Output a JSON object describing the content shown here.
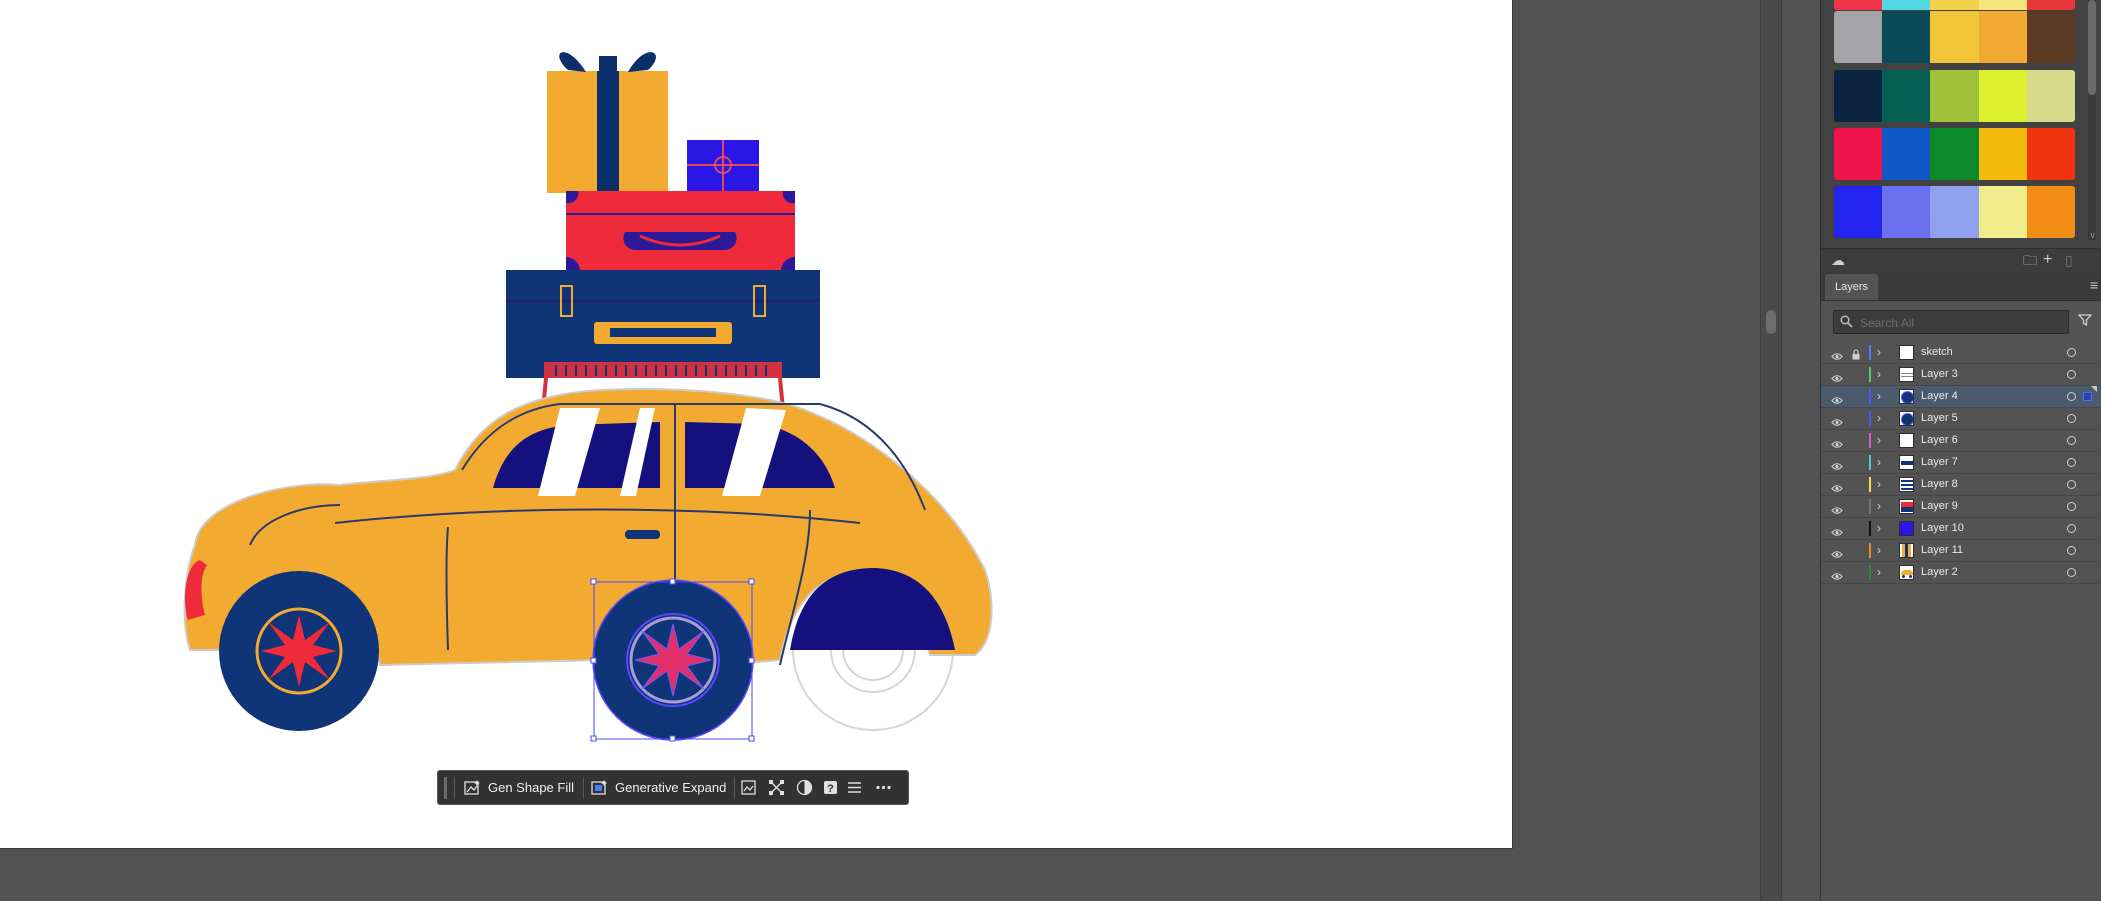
{
  "task_bar": {
    "gen_shape_fill": "Gen Shape Fill",
    "generative_expand": "Generative Expand"
  },
  "swatches": {
    "rows": [
      [
        "#f0344a",
        "#56d7e4",
        "#f2d14b",
        "#f6e47c",
        "#e8383a"
      ],
      [
        "#a3a3a8",
        "#0a4b5a",
        "#f3c63a",
        "#f2a932",
        "#5a3a22"
      ],
      [
        "#0b2340",
        "#036053",
        "#9fc13a",
        "#deef2e",
        "#d9d98c"
      ],
      [
        "#f0144c",
        "#0f58c5",
        "#0a8a28",
        "#f3b90d",
        "#f1340f"
      ],
      [
        "#2424f0",
        "#6a70ee",
        "#8ea0ee",
        "#f3ec8c",
        "#f28c14"
      ]
    ]
  },
  "layers_panel": {
    "tab_label": "Layers",
    "search_placeholder": "Search All",
    "layers": [
      {
        "name": "sketch",
        "color": "#4f7bff",
        "locked": true,
        "selected": false,
        "thumb": "blank"
      },
      {
        "name": "Layer 3",
        "color": "#4ed36b",
        "locked": false,
        "selected": false,
        "thumb": "lines"
      },
      {
        "name": "Layer 4",
        "color": "#4c55ff",
        "locked": false,
        "selected": true,
        "thumb": "wheel"
      },
      {
        "name": "Layer 5",
        "color": "#4c55ff",
        "locked": false,
        "selected": false,
        "thumb": "wheel"
      },
      {
        "name": "Layer 6",
        "color": "#d75cc9",
        "locked": false,
        "selected": false,
        "thumb": "blank"
      },
      {
        "name": "Layer 7",
        "color": "#55c8d8",
        "locked": false,
        "selected": false,
        "thumb": "case-blue"
      },
      {
        "name": "Layer 8",
        "color": "#f0e24a",
        "locked": false,
        "selected": false,
        "thumb": "stripes"
      },
      {
        "name": "Layer 9",
        "color": "#777777",
        "locked": false,
        "selected": false,
        "thumb": "case-red"
      },
      {
        "name": "Layer 10",
        "color": "#111111",
        "locked": false,
        "selected": false,
        "thumb": "gift-blue"
      },
      {
        "name": "Layer 11",
        "color": "#f08a2a",
        "locked": false,
        "selected": false,
        "thumb": "gift-yellow"
      },
      {
        "name": "Layer 2",
        "color": "#2a8a3a",
        "locked": false,
        "selected": false,
        "thumb": "car"
      }
    ]
  }
}
